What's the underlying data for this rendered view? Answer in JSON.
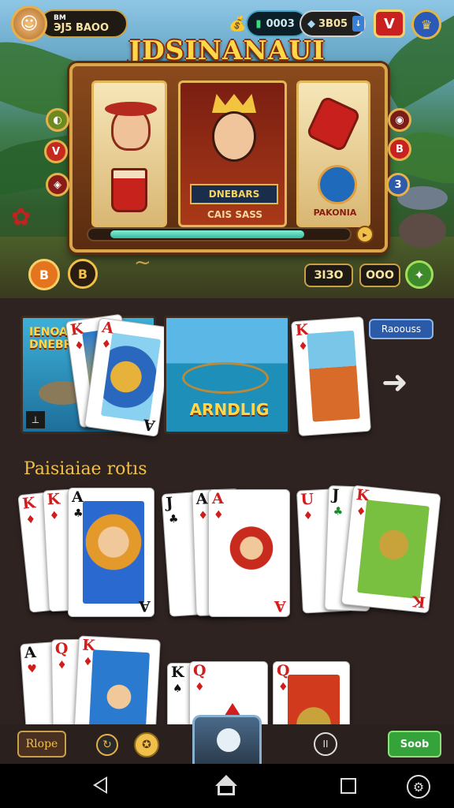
{
  "hud": {
    "profile_label": "BM",
    "profile_value": "ЭJ5 BAOO",
    "coins_value": "0003",
    "gems_value": "3B05",
    "v_label": "V"
  },
  "game": {
    "title": "JDSINANAUI",
    "reel_mid_banner": "DNEBARS",
    "reel_mid_sub": "CAIS SASS",
    "reel_right_banner": "PAKONIA",
    "progress": 0.74,
    "left_buttons": [
      "B",
      "B"
    ],
    "bet_value": "ЗIЗO",
    "win_value": "OOO"
  },
  "featured": {
    "thumb1_label": "IENOANAI DNEBRALS",
    "thumb2_label": "ARNDLIG",
    "badge_label": "Raoouss"
  },
  "section": {
    "title": "Paisiaiae rotıs"
  },
  "bottom_bar": {
    "home_label": "Rlope",
    "play_label": "Soob",
    "pause_label": "II"
  },
  "colors": {
    "gold": "#f1c04a",
    "card_red": "#d21d1d",
    "play_green": "#33a33a"
  }
}
